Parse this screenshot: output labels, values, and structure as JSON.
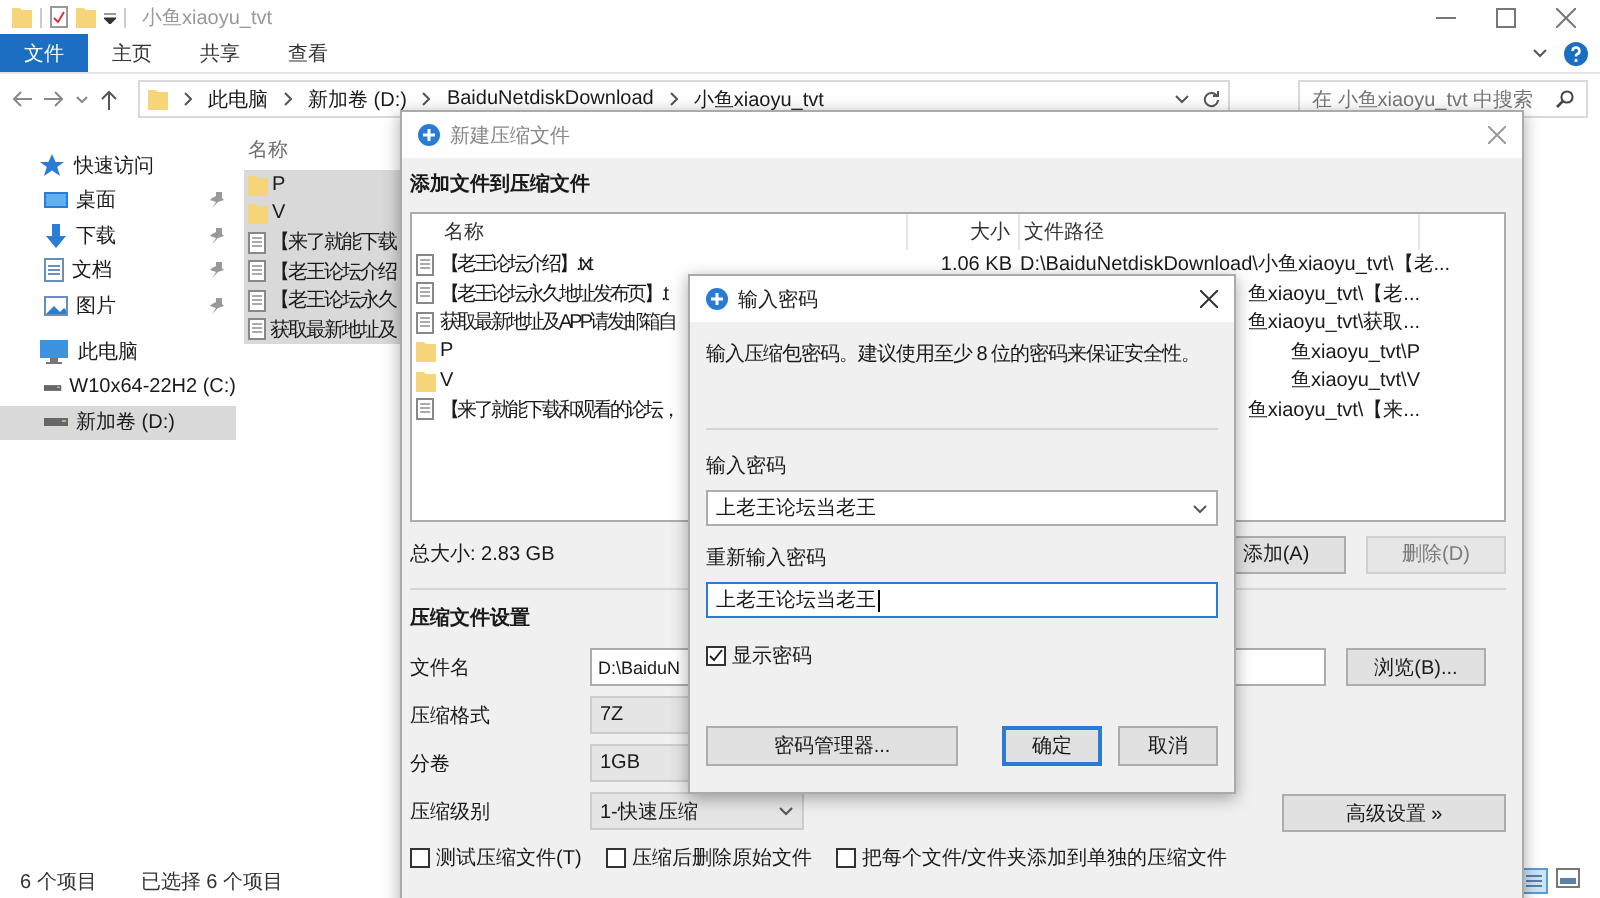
{
  "explorer": {
    "title": "小鱼xiaoyu_tvt",
    "ribbon_tabs": [
      {
        "label": "文件",
        "selected": true
      },
      {
        "label": "主页",
        "selected": false
      },
      {
        "label": "共享",
        "selected": false
      },
      {
        "label": "查看",
        "selected": false
      }
    ],
    "breadcrumb": [
      "此电脑",
      "新加卷 (D:)",
      "BaiduNetdiskDownload",
      "小鱼xiaoyu_tvt"
    ],
    "search": {
      "placeholder": "在 小鱼xiaoyu_tvt 中搜索"
    },
    "sidebar": {
      "items": [
        {
          "label": "快速访问",
          "kind": "star",
          "selected": false,
          "children": [
            {
              "label": "桌面",
              "kind": "desktop",
              "pinned": true,
              "selected": false
            },
            {
              "label": "下载",
              "kind": "download",
              "pinned": true,
              "selected": false
            },
            {
              "label": "文档",
              "kind": "document",
              "pinned": true,
              "selected": false
            },
            {
              "label": "图片",
              "kind": "picture",
              "pinned": true,
              "selected": false
            }
          ]
        },
        {
          "label": "此电脑",
          "kind": "pc",
          "selected": false,
          "children": [
            {
              "label": "W10x64-22H2 (C:)",
              "kind": "drive",
              "pinned": false,
              "selected": false
            },
            {
              "label": "新加卷 (D:)",
              "kind": "drive",
              "pinned": false,
              "selected": true
            }
          ]
        }
      ]
    },
    "file_list": {
      "columns": [
        "名称"
      ],
      "rows": [
        {
          "name": "P",
          "kind": "folder",
          "selected": true
        },
        {
          "name": "V",
          "kind": "folder",
          "selected": true
        },
        {
          "name": "【来了就能下载",
          "kind": "file",
          "selected": true
        },
        {
          "name": "【老王论坛介绍",
          "kind": "file",
          "selected": true
        },
        {
          "name": "【老王论坛永久",
          "kind": "file",
          "selected": true
        },
        {
          "name": "获取最新地址及",
          "kind": "file",
          "selected": true
        }
      ]
    },
    "status_bar": {
      "item_count": "6 个项目",
      "selection": "已选择 6 个项目"
    }
  },
  "archive_dialog": {
    "title": "新建压缩文件",
    "heading": "添加文件到压缩文件",
    "list": {
      "columns": [
        "名称",
        "大小",
        "文件路径"
      ],
      "rows": [
        {
          "name": "【老王论坛介绍】.txt",
          "kind": "file",
          "size": "1.06 KB",
          "path": "D:\\BaiduNetdiskDownload\\小鱼xiaoyu_tvt\\【老..."
        },
        {
          "name": "【老王论坛永久地址发布页】.t",
          "kind": "file",
          "path": "鱼xiaoyu_tvt\\【老..."
        },
        {
          "name": "获取最新地址及APP请发邮箱自",
          "kind": "file",
          "path": "鱼xiaoyu_tvt\\获取..."
        },
        {
          "name": "P",
          "kind": "folder",
          "path": "鱼xiaoyu_tvt\\P"
        },
        {
          "name": "V",
          "kind": "folder",
          "path": "鱼xiaoyu_tvt\\V"
        },
        {
          "name": "【来了就能下载和观看的论坛，",
          "kind": "file",
          "path": "鱼xiaoyu_tvt\\【来..."
        }
      ]
    },
    "total_size": "总大小: 2.83 GB",
    "list_buttons": [
      {
        "label": "添加(A)",
        "disabled": false
      },
      {
        "label": "删除(D)",
        "disabled": true
      }
    ],
    "settings": {
      "heading": "压缩文件设置",
      "fields": [
        {
          "label": "文件名",
          "kind": "text",
          "value": "D:\\BaiduN"
        },
        {
          "label": "压缩格式",
          "kind": "select",
          "value": "7Z"
        },
        {
          "label": "分卷",
          "kind": "select",
          "value": "1GB"
        },
        {
          "label": "压缩级别",
          "kind": "select",
          "value": "1-快速压缩"
        }
      ],
      "browse_button": "浏览(B)...",
      "advanced_button": "高级设置 »",
      "options": [
        {
          "label": "测试压缩文件(T)",
          "checked": false
        },
        {
          "label": "压缩后删除原始文件",
          "checked": false
        },
        {
          "label": "把每个文件/文件夹添加到单独的压缩文件",
          "checked": false
        }
      ]
    }
  },
  "password_dialog": {
    "title": "输入密码",
    "message": "输入压缩包密码。建议使用至少 8 位的密码来保证安全性。",
    "password_label": "输入密码",
    "password": "上老王论坛当老王",
    "confirm_label": "重新输入密码",
    "confirm": "上老王论坛当老王",
    "show_password": {
      "label": "显示密码",
      "checked": true
    },
    "buttons": [
      {
        "label": "密码管理器...",
        "default": false
      },
      {
        "label": "确定",
        "default": true
      },
      {
        "label": "取消",
        "default": false
      }
    ]
  }
}
